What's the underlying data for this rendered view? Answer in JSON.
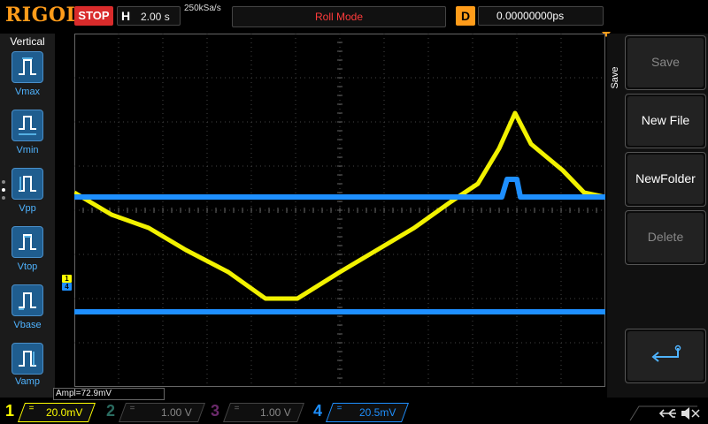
{
  "brand": "RIGOL",
  "run_state": "STOP",
  "horizontal": {
    "key": "H",
    "scale": "2.00 s"
  },
  "sample_rate": "250kSa/s",
  "mode": "Roll Mode",
  "delay": {
    "key": "D",
    "value": "0.00000000ps"
  },
  "left_menu": {
    "title": "Vertical",
    "items": [
      {
        "label": "Vmax",
        "icon": "vmax-icon"
      },
      {
        "label": "Vmin",
        "icon": "vmin-icon"
      },
      {
        "label": "Vpp",
        "icon": "vpp-icon"
      },
      {
        "label": "Vtop",
        "icon": "vtop-icon"
      },
      {
        "label": "Vbase",
        "icon": "vbase-icon"
      },
      {
        "label": "Vamp",
        "icon": "vamp-icon"
      }
    ]
  },
  "right_menu": {
    "title": "Save",
    "keys": [
      {
        "label": "Save",
        "enabled": false
      },
      {
        "label": "New File",
        "enabled": true
      },
      {
        "label": "NewFolder",
        "enabled": true
      },
      {
        "label": "Delete",
        "enabled": false
      }
    ],
    "return_icon": "return-icon"
  },
  "measurement": "Ampl=72.9mV",
  "channels": [
    {
      "num": "1",
      "scale": "20.0mV",
      "coupling": "=",
      "color": "#ffff00",
      "active": true
    },
    {
      "num": "2",
      "scale": "1.00 V",
      "coupling": "=",
      "color": "#00c0a0",
      "active": false
    },
    {
      "num": "3",
      "scale": "1.00 V",
      "coupling": "=",
      "color": "#ff40ff",
      "active": false
    },
    {
      "num": "4",
      "scale": "20.5mV",
      "coupling": "=",
      "color": "#1e8fff",
      "active": true
    }
  ],
  "channel_markers": [
    {
      "label": "1",
      "color": "#ffff00"
    },
    {
      "label": "4",
      "color": "#1e8fff"
    }
  ],
  "status_icons": [
    "usb-icon",
    "mute-speaker-icon"
  ],
  "colors": {
    "accent": "#ff9c1a",
    "stop": "#d92b2b",
    "ch1": "#ffff00",
    "ch4": "#1e8fff",
    "panel_text": "#4fb3ff"
  },
  "waveforms": {
    "ch1": {
      "time_div": [
        0,
        0.7,
        1.4,
        2.1,
        2.9,
        3.6,
        4.2,
        5.0,
        5.7,
        6.4,
        7.1,
        7.6,
        8.0,
        8.3,
        8.6,
        8.9,
        9.2,
        9.6,
        10
      ],
      "level_div": [
        4.4,
        3.9,
        3.6,
        3.1,
        2.6,
        2.0,
        2.0,
        2.6,
        3.1,
        3.6,
        4.2,
        4.6,
        5.4,
        6.2,
        5.5,
        5.2,
        4.9,
        4.4,
        4.3
      ]
    },
    "ch4": {
      "baseline_div": 4.3,
      "pulse_start_div": 8.05,
      "pulse_end_div": 8.4,
      "pulse_level_div": 4.7,
      "lower_trace_div": 1.7
    }
  }
}
